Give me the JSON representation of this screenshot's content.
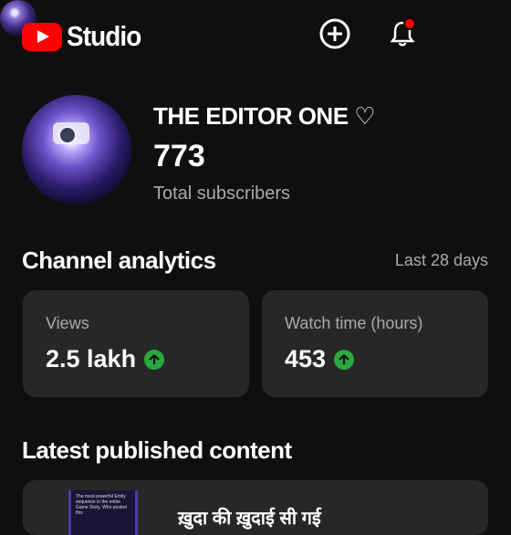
{
  "header": {
    "app_name": "Studio",
    "icons": [
      "youtube-logo",
      "create-icon",
      "notifications-icon",
      "avatar"
    ],
    "notification_dot": true,
    "brand_color": "#ff0000"
  },
  "channel": {
    "name": "THE EDITOR ONE ♡",
    "subscribers": "773",
    "subscribers_label": "Total subscribers"
  },
  "analytics": {
    "title": "Channel analytics",
    "range": "Last 28 days",
    "cards": [
      {
        "label": "Views",
        "value": "2.5 lakh",
        "trend": "up"
      },
      {
        "label": "Watch time (hours)",
        "value": "453",
        "trend": "up"
      }
    ],
    "trend_color": "#2ba640"
  },
  "latest": {
    "title": "Latest published content",
    "thumbnail_text": "The most powerful Emily sequence in the entire Game Story. Who posted this",
    "item_title": "ख़ुदा की ख़ुदाई सी गई"
  }
}
